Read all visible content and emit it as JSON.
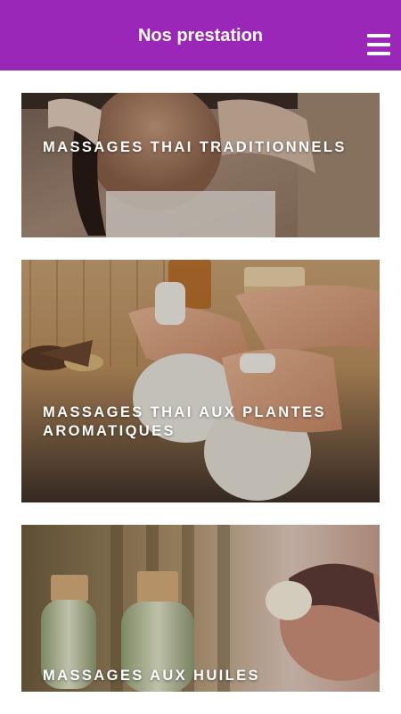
{
  "header": {
    "title": "Nos prestation",
    "menu_icon": "hamburger-menu-icon",
    "background_color": "#9a27b7"
  },
  "services": [
    {
      "label": "MASSAGES THAI TRADITIONNELS",
      "image": "woman-receiving-back-massage-photo"
    },
    {
      "label": "MASSAGES THAI AUX PLANTES AROMATIQUES",
      "image": "herbal-compress-massage-photo"
    },
    {
      "label": "MASSAGES AUX HUILES",
      "image": "massage-oil-bottles-photo"
    }
  ]
}
